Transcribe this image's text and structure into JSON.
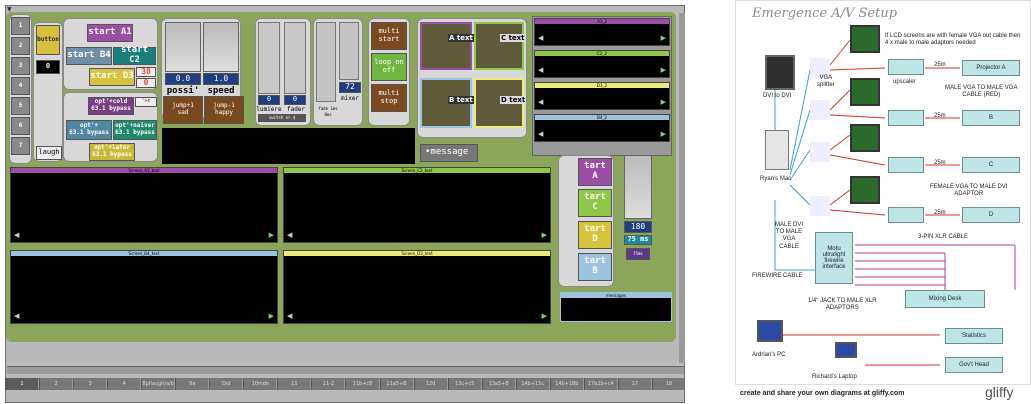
{
  "patcher": {
    "left_buttons": [
      "1",
      "2",
      "3",
      "4",
      "5",
      "6",
      "7"
    ],
    "utility": {
      "button": "button",
      "count": "0",
      "laugh": "laugh"
    },
    "start_buttons": {
      "a": "start A1",
      "b": "start B4",
      "c": "start C2",
      "d": "start D3",
      "d_num": "30",
      "d_num2": "0"
    },
    "opt_buttons": {
      "cold": "opt'+cold\n63.1 bypass",
      "cold_tag": "'+c",
      "minus": "opt'+\n63.1 bypass",
      "naive": "opt'+naiver\n63.1 bypass",
      "later": "opt'+later\n63.1 bypass"
    },
    "sliders": {
      "pos_value": "0.0",
      "speed_value": "1.0",
      "pos_label": "possi'",
      "speed_label": "speed"
    },
    "jumps": {
      "sad": "jump+1\nsad",
      "happy": "jump-1\nhappy"
    },
    "lumiere": {
      "lum_value": "0",
      "fader_value": "0",
      "lum_label": "lumiere",
      "fader_label": "fader",
      "switch": "switch or $"
    },
    "mixer": {
      "value": "72",
      "label": "mixer",
      "fade": "fade 1ms",
      "fade2": "8ms"
    },
    "multi": {
      "start": "multi\nstart",
      "loop": "loop on\noff",
      "stop": "multi\nstop"
    },
    "texts": {
      "a": "A text",
      "b": "B text",
      "c": "C text",
      "d": "D text"
    },
    "message": "message",
    "right_strip": [
      "A1_2",
      "C2_2",
      "D3_2",
      "B4_2"
    ],
    "screens": [
      {
        "label": "Screen_A1_text",
        "color": "#9b4ea6"
      },
      {
        "label": "Screen_C2_text",
        "color": "#8fc848"
      },
      {
        "label": "Screen_B4_text",
        "color": "#9cc3df"
      },
      {
        "label": "Screen_D3_text",
        "color": "#ebeb7a"
      }
    ],
    "start_col": [
      "tart A",
      "tart C",
      "tart D",
      "tart B"
    ],
    "right_slider": {
      "value": "180",
      "ms": "75 ms",
      "tag": "75ms"
    },
    "messages": "messages",
    "tabs": [
      "1",
      "2",
      "3",
      "4",
      "8p/laugh/a/b",
      "8a",
      "Did",
      "10mdn",
      "11",
      "11-2",
      "11b+c8",
      "11a5+B",
      "12d",
      "13c+c5",
      "13a5+B",
      "14b+15c",
      "14b+18b",
      "17b2b+c4",
      "17",
      "18"
    ]
  },
  "diagram": {
    "title": "Emergence A/V Setup",
    "note": "If LCD screens are with female VGA out cable then\n4 x male to male adaptors needed",
    "dvi_to_dvi": "DVI to DVI",
    "vga_splitter": "VGA\nsplitter",
    "upscaler": "upscaler",
    "ryans_mac": "Ryan's Mac",
    "projectors": [
      "Projector A",
      "B",
      "C",
      "D"
    ],
    "dist": [
      "25m",
      "25m",
      "25m",
      "25m"
    ],
    "male_vga": "MALE VGA TO MALE VGA\nCABLE (RED)",
    "female_vga": "FEMALE VGA TO MALE DVI\nADAPTOR",
    "male_dvi": "MALE DVI\nTO MALE\nVGA\nCABLE",
    "xlr": "3-PIN XLR CABLE",
    "motu": "Motu\nultralight\nfirewire\ninterface",
    "firewire": "FIREWIRE CABLE",
    "jack": "1/4\" JACK TO MALE XLR\nADAPTORS",
    "mixing": "Mixing Desk",
    "statistics": "Statistics",
    "govt": "Gov't Head",
    "ardrian": "Ardrian's PC",
    "richard": "Richard's Laptop",
    "footer": "create and share your own diagrams at gliffy.com",
    "brand": "gliffy"
  }
}
